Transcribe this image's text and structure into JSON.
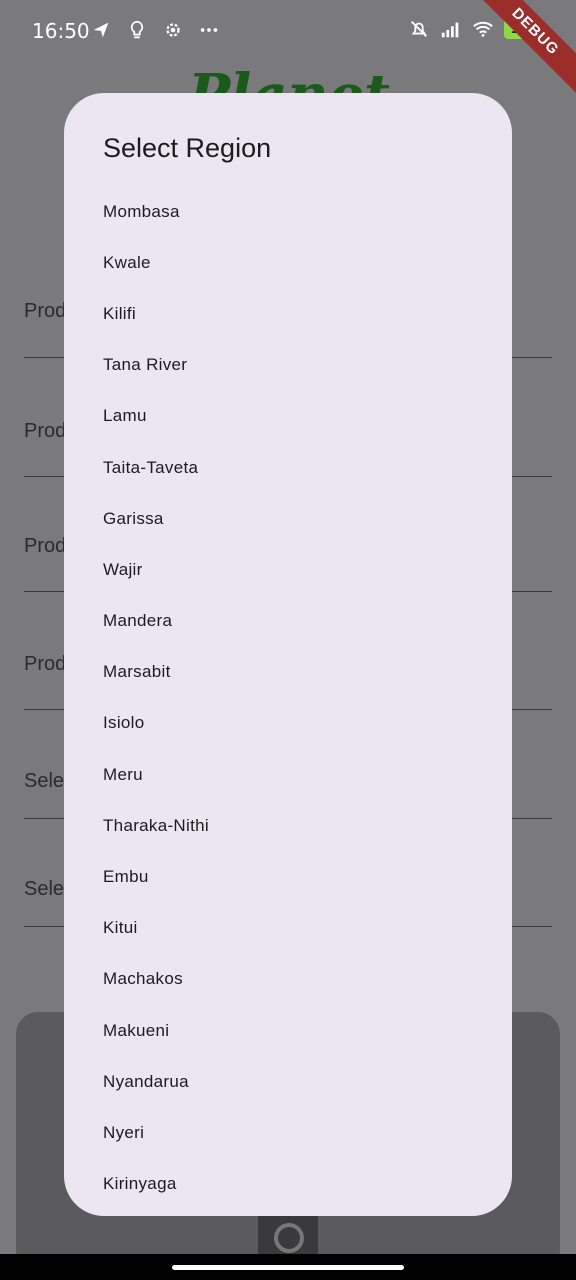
{
  "status_bar": {
    "time": "16:50",
    "battery": "100",
    "left_icons": [
      "location-arrow-icon",
      "bulb-icon",
      "settings-gear-icon",
      "more-dots-icon"
    ],
    "right_icons": [
      "mute-bell-icon",
      "signal-icon",
      "wifi-icon",
      "battery-icon"
    ]
  },
  "debug_banner": "DEBUG",
  "background": {
    "logo": "Planet",
    "fields": [
      "Prod",
      "Prod",
      "Prod",
      "Prod",
      "Sele",
      "Sele"
    ]
  },
  "dialog": {
    "title": "Select Region",
    "regions": [
      "Mombasa",
      "Kwale",
      "Kilifi",
      "Tana River",
      "Lamu",
      "Taita-Taveta",
      "Garissa",
      "Wajir",
      "Mandera",
      "Marsabit",
      "Isiolo",
      "Meru",
      "Tharaka-Nithi",
      "Embu",
      "Kitui",
      "Machakos",
      "Makueni",
      "Nyandarua",
      "Nyeri",
      "Kirinyaga"
    ]
  },
  "colors": {
    "dialog_bg": "#ece6f3",
    "scrim": "#7a7a7c",
    "debug_ribbon": "#9b2d2a",
    "logo_green": "#1a5a1a"
  }
}
